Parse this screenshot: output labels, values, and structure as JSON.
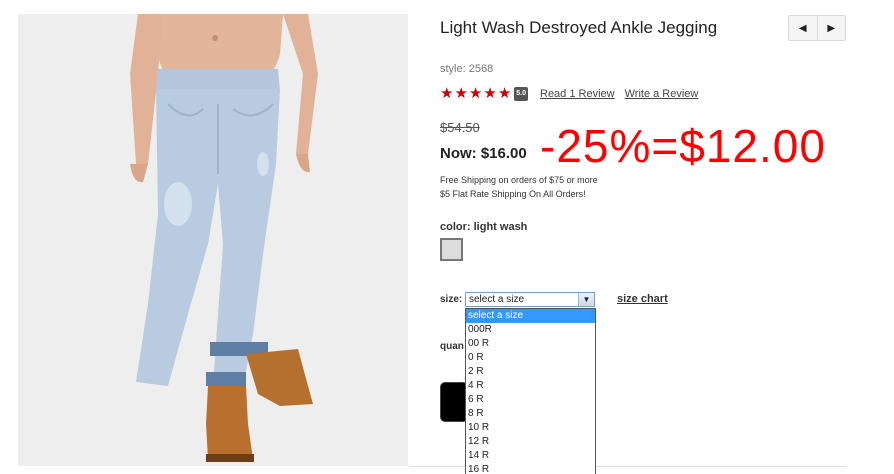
{
  "product": {
    "title": "Light Wash Destroyed Ankle Jegging",
    "style": "style: 2568",
    "image_alt": "jeans-photo"
  },
  "nav": {
    "prev_icon": "caret-left-icon",
    "next_icon": "caret-right-icon"
  },
  "rating": {
    "stars": 5,
    "score": "5.0",
    "read_reviews": "Read 1 Review",
    "write_review": "Write a Review"
  },
  "pricing": {
    "was": "$54.50",
    "now": "Now: $16.00",
    "promo": "-25%=$12.00"
  },
  "shipping": {
    "line1": "Free Shipping on orders of $75 or more",
    "line2": "$5 Flat Rate Shipping On All Orders!"
  },
  "color": {
    "label": "color:",
    "value": "light wash",
    "swatch": "#dcdcdc"
  },
  "size": {
    "label": "size:",
    "selected": "select a size",
    "chart_link": "size chart",
    "options": [
      "select a size",
      "000R",
      "00 R",
      "0 R",
      "2 R",
      "4 R",
      "6 R",
      "8 R",
      "10 R",
      "12 R",
      "14 R",
      "16 R"
    ]
  },
  "quantity": {
    "label": "quan"
  },
  "colors": {
    "accent_red": "#cc0000",
    "promo_red": "#ff0000",
    "dropdown_highlight": "#3399ff"
  }
}
